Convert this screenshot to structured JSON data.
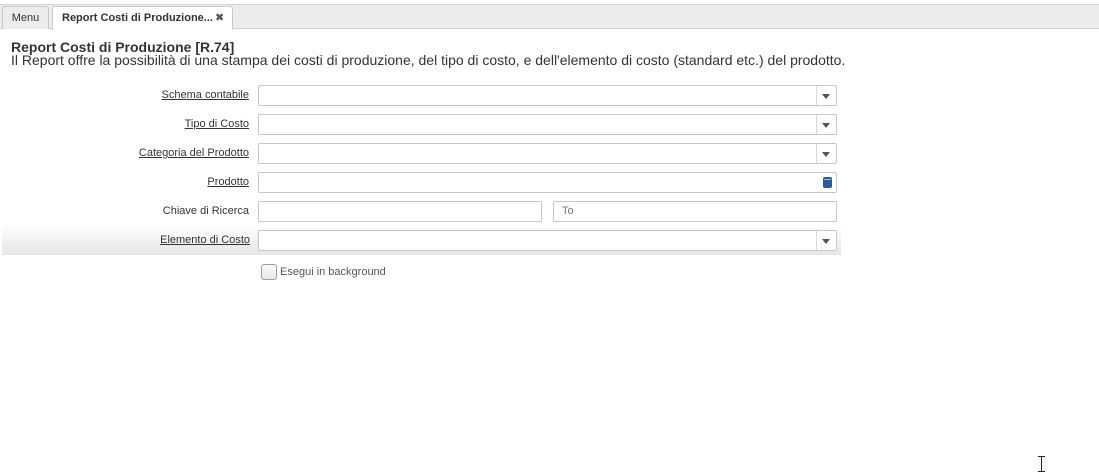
{
  "tabs": [
    {
      "label": "Menu"
    },
    {
      "label": "Report Costi di Produzione..."
    }
  ],
  "tab_close_glyph": "✖",
  "header": {
    "title": "Report Costi di Produzione [R.74]",
    "description": "Il Report offre la possibilità di una stampa dei costi di produzione, del tipo di costo, e dell'elemento di costo (standard etc.) del prodotto."
  },
  "form": {
    "schema_contabile": {
      "label": "Schema contabile",
      "value": ""
    },
    "tipo_di_costo": {
      "label": "Tipo di Costo",
      "value": ""
    },
    "categoria_prodotto": {
      "label": "Categoria del Prodotto",
      "value": ""
    },
    "prodotto": {
      "label": "Prodotto",
      "value": ""
    },
    "chiave_di_ricerca": {
      "label": "Chiave di Ricerca",
      "from_value": "",
      "to_placeholder": "To"
    },
    "elemento_di_costo": {
      "label": "Elemento di Costo",
      "value": ""
    },
    "background": {
      "label": "Esegui in background",
      "checked": false
    }
  },
  "icons": {
    "dropdown": "chevron-down-icon",
    "search": "search-icon",
    "close": "close-icon",
    "cursor": "text-cursor-icon"
  },
  "colors": {
    "search_icon": "#2a5b9a",
    "highlight_row": "#e6e6e6"
  }
}
